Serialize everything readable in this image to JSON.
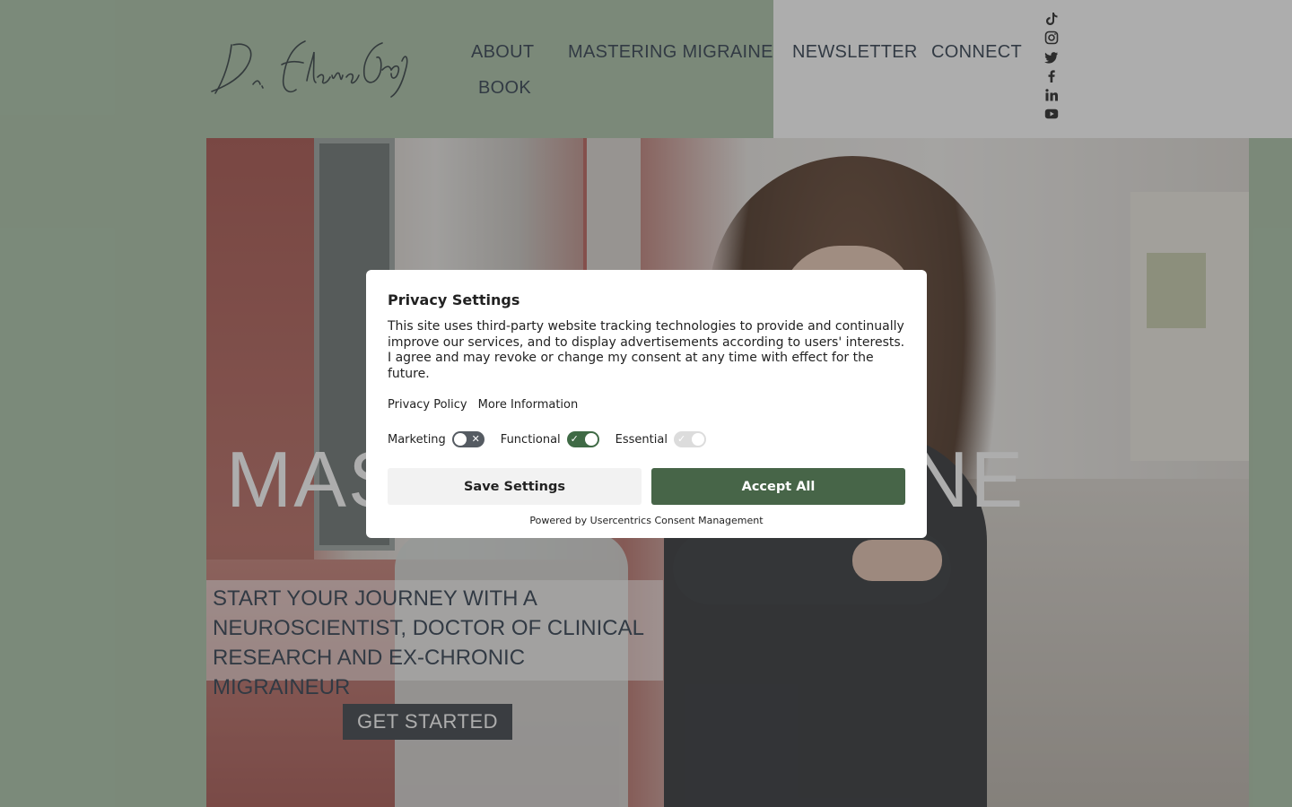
{
  "header": {
    "logo_text": "Dr. Elena Groß",
    "nav": [
      "ABOUT",
      "MASTERING MIGRAINE",
      "NEWSLETTER",
      "CONNECT",
      "BOOK"
    ],
    "social_icons": [
      "tiktok-icon",
      "instagram-icon",
      "twitter-icon",
      "facebook-icon",
      "linkedin-icon",
      "youtube-icon"
    ]
  },
  "hero": {
    "title_start": "MAS",
    "title_end": "NE",
    "tagline": "START YOUR JOURNEY WITH A NEUROSCIENTIST, DOCTOR OF CLINICAL RESEARCH AND EX-CHRONIC MIGRAINEUR",
    "cta_label": "GET STARTED"
  },
  "consent": {
    "title": "Privacy Settings",
    "description": "This site uses third-party website tracking technologies to provide and continually improve our services, and to display advertisements according to users' interests. I agree and may revoke or change my consent at any time with effect for the future.",
    "links": [
      "Privacy Policy",
      "More Information"
    ],
    "toggles": [
      {
        "label": "Marketing",
        "state": "off"
      },
      {
        "label": "Functional",
        "state": "on"
      },
      {
        "label": "Essential",
        "state": "on-disabled"
      }
    ],
    "save_label": "Save Settings",
    "accept_label": "Accept All",
    "powered_by": "Powered by Usercentrics Consent Management"
  },
  "colors": {
    "sage_background": "#a9c2a6",
    "accept_button": "#476548",
    "functional_toggle": "#3f6a45",
    "marketing_toggle": "#555b62",
    "nav_text": "#2b3a4a"
  }
}
